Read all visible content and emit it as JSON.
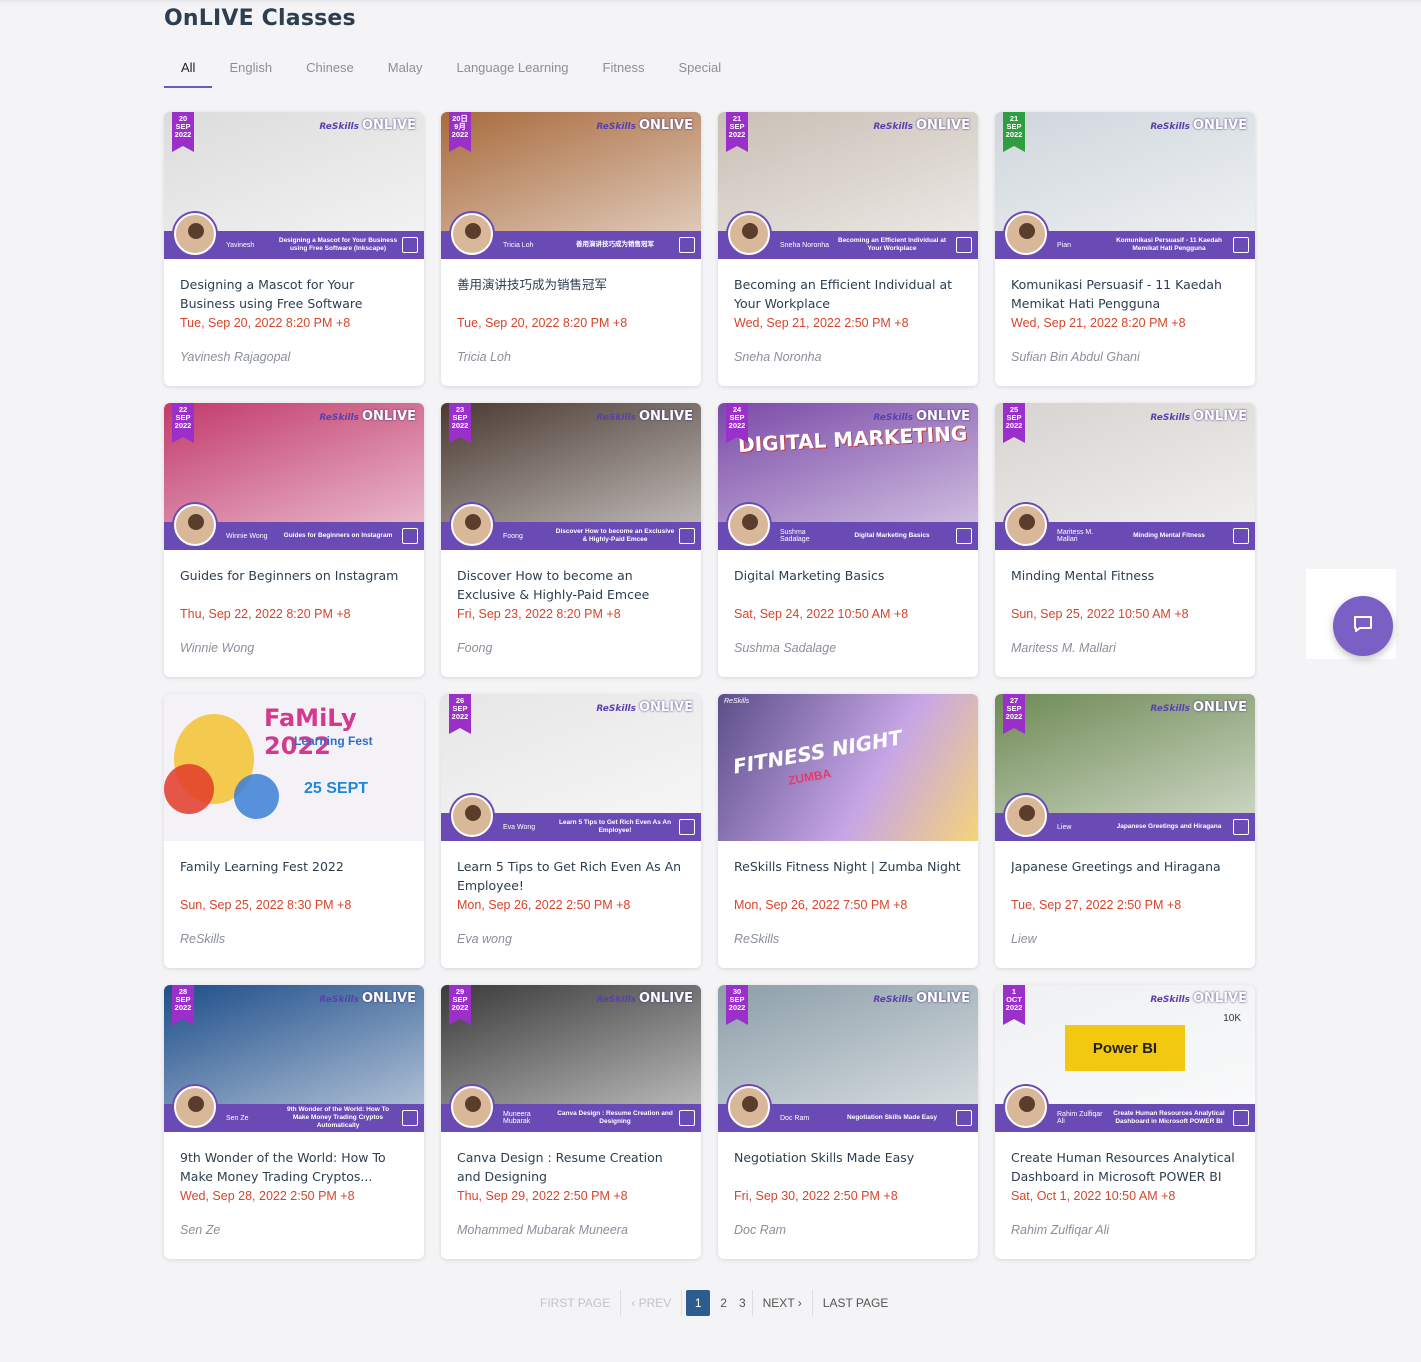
{
  "page": {
    "title": "OnLIVE Classes"
  },
  "tabs": [
    "All",
    "English",
    "Chinese",
    "Malay",
    "Language Learning",
    "Fitness",
    "Special"
  ],
  "cards": [
    {
      "title": "Designing a Mascot for Your Business using Free Software (Inkscape)",
      "date": "Tue, Sep 20, 2022 8:20 PM +8",
      "author": "Yavinesh Rajagopal",
      "ribbon": "20 SEP 2022",
      "band_name": "Yavinesh",
      "band_title": "Designing a Mascot for Your Business using Free Software (Inkscape)",
      "bg": "#dcdcdc",
      "ribbon_color": "#9b2fc9"
    },
    {
      "title": "善用演讲技巧成为销售冠军",
      "date": "Tue, Sep 20, 2022 8:20 PM +8",
      "author": "Tricia Loh",
      "ribbon": "20日 9月 2022",
      "band_name": "Tricia Loh",
      "band_title": "善用演讲技巧成为销售冠军",
      "bg": "#a86b3d",
      "ribbon_color": "#9b2fc9"
    },
    {
      "title": "Becoming an Efficient Individual at Your Workplace",
      "date": "Wed, Sep 21, 2022 2:50 PM +8",
      "author": "Sneha Noronha",
      "ribbon": "21 SEP 2022",
      "band_name": "Sneha Noronha",
      "band_title": "Becoming an Efficient Individual at Your Workplace",
      "bg": "#c9bfb5",
      "ribbon_color": "#9b2fc9"
    },
    {
      "title": "Komunikasi Persuasif - 11 Kaedah Memikat Hati Pengguna",
      "date": "Wed, Sep 21, 2022 8:20 PM +8",
      "author": "Sufian Bin Abdul Ghani",
      "ribbon": "21 SEP 2022",
      "band_name": "Pian",
      "band_title": "Komunikasi Persuasif - 11 Kaedah Memikat Hati Pengguna",
      "bg": "#cfd6dc",
      "ribbon_color": "#2e9e3e"
    },
    {
      "title": "Guides for Beginners on Instagram",
      "date": "Thu, Sep 22, 2022 8:20 PM +8",
      "author": "Winnie Wong",
      "ribbon": "22 SEP 2022",
      "band_name": "Winnie Wong",
      "band_title": "Guides for Beginners on Instagram",
      "bg": "#c23a6b",
      "ribbon_color": "#9b2fc9"
    },
    {
      "title": "Discover How to become an Exclusive & Highly-Paid Emcee",
      "date": "Fri, Sep 23, 2022 8:20 PM +8",
      "author": "Foong",
      "ribbon": "23 SEP 2022",
      "band_name": "Foong",
      "band_title": "Discover How to become an Exclusive & Highly-Paid Emcee",
      "bg": "#4a3a32",
      "ribbon_color": "#9b2fc9"
    },
    {
      "title": "Digital Marketing Basics",
      "date": "Sat, Sep 24, 2022 10:50 AM +8",
      "author": "Sushma Sadalage",
      "ribbon": "24 SEP 2022",
      "band_name": "Sushma Sadalage",
      "band_title": "Digital Marketing Basics",
      "bg": "#7a4aa8",
      "ribbon_color": "#9b2fc9"
    },
    {
      "title": "Minding Mental Fitness",
      "date": "Sun, Sep 25, 2022 10:50 AM +8",
      "author": "Maritess M. Mallari",
      "ribbon": "25 SEP 2022",
      "band_name": "Maritess M. Mallari",
      "band_title": "Minding Mental Fitness",
      "bg": "#d6d3cf",
      "ribbon_color": "#9b2fc9"
    },
    {
      "title": "Family Learning Fest 2022",
      "date": "Sun, Sep 25, 2022 8:30 PM +8",
      "author": "ReSkills",
      "ribbon": "",
      "band_name": "",
      "band_title": "",
      "bg": "#f0eef3",
      "ribbon_color": ""
    },
    {
      "title": "Learn 5 Tips to Get Rich Even As An Employee!",
      "date": "Mon, Sep 26, 2022 2:50 PM +8",
      "author": "Eva wong",
      "ribbon": "26 SEP 2022",
      "band_name": "Eva Wong",
      "band_title": "Learn 5 Tips to Get Rich Even As An Employee!",
      "bg": "#e6e6e6",
      "ribbon_color": "#9b2fc9"
    },
    {
      "title": "ReSkills Fitness Night | Zumba Night",
      "date": "Mon, Sep 26, 2022 7:50 PM +8",
      "author": "ReSkills",
      "ribbon": "",
      "band_name": "",
      "band_title": "",
      "bg": "#8e7fb0",
      "ribbon_color": ""
    },
    {
      "title": "Japanese Greetings and Hiragana",
      "date": "Tue, Sep 27, 2022 2:50 PM +8",
      "author": "Liew",
      "ribbon": "27 SEP 2022",
      "band_name": "Liew",
      "band_title": "Japanese Greetings and Hiragana",
      "bg": "#6e8a55",
      "ribbon_color": "#9b2fc9"
    },
    {
      "title": "9th Wonder of the World: How To Make Money Trading Cryptos...",
      "date": "Wed, Sep 28, 2022 2:50 PM +8",
      "author": "Sen Ze",
      "ribbon": "28 SEP 2022",
      "band_name": "Sen Ze",
      "band_title": "9th Wonder of the World: How To Make Money Trading Cryptos Automatically",
      "bg": "#1e4e8a",
      "ribbon_color": "#9b2fc9"
    },
    {
      "title": "Canva Design : Resume Creation and Designing",
      "date": "Thu, Sep 29, 2022 2:50 PM +8",
      "author": "Mohammed Mubarak Muneera",
      "ribbon": "29 SEP 2022",
      "band_name": "Muneera Mubarak",
      "band_title": "Canva Design : Resume Creation and Designing",
      "bg": "#3a3a3a",
      "ribbon_color": "#9b2fc9"
    },
    {
      "title": "Negotiation Skills Made Easy",
      "date": "Fri, Sep 30, 2022 2:50 PM +8",
      "author": "Doc Ram",
      "ribbon": "30 SEP 2022",
      "band_name": "Doc Ram",
      "band_title": "Negotiation Skills Made Easy",
      "bg": "#8c9ea8",
      "ribbon_color": "#9b2fc9"
    },
    {
      "title": "Create Human Resources Analytical Dashboard in Microsoft POWER BI",
      "date": "Sat, Oct 1, 2022 10:50 AM +8",
      "author": "Rahim Zulfiqar Ali",
      "ribbon": "1 OCT 2022",
      "band_name": "Rahim Zulfiqar Ali",
      "band_title": "Create Human Resources Analytical Dashboard in Microsoft POWER BI",
      "bg": "#eef0f2",
      "ribbon_color": "#9b2fc9"
    }
  ],
  "thumb_text": {
    "onlive": "ONLIVE",
    "reskills": "ReSkills",
    "family_title": "FaMiLy 2022",
    "family_sub": "Learning Fest",
    "family_date": "25 SEPT",
    "fitness_title": "FITNESS NIGHT",
    "fitness_sub": "ZUMBA",
    "digital": "DIGITAL MARKETING",
    "powerbi": "Power BI",
    "powerbi_kpi": "10K"
  },
  "pagination": {
    "first": "FIRST PAGE",
    "prev": "‹ PREV",
    "pages": [
      "1",
      "2",
      "3"
    ],
    "current": "1",
    "next": "NEXT ›",
    "last": "LAST PAGE"
  },
  "colors": {
    "accent": "#6a4bb5",
    "date": "#d6452b",
    "current_page": "#2d5c8e",
    "chat": "#7a5fc4"
  },
  "icons": {
    "chat": "chat-bubble-icon"
  }
}
